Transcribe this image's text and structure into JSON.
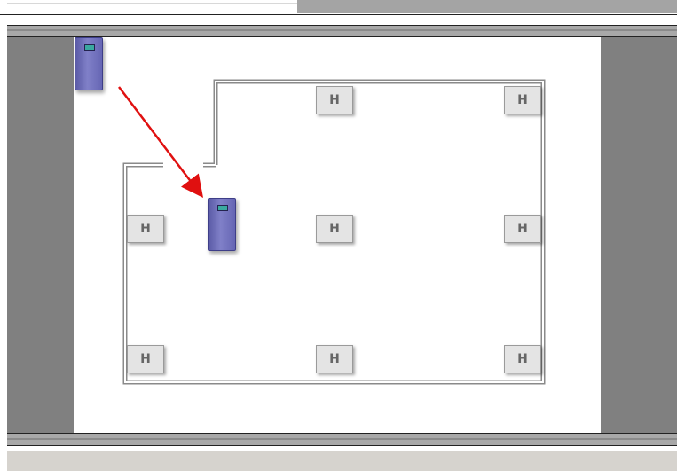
{
  "floorplan": {
    "room_marker_label": "H",
    "markers_count_label": "",
    "arrow_color": "#e01010",
    "server_color": "#7878c0",
    "device_icon": "server-rack-icon"
  }
}
